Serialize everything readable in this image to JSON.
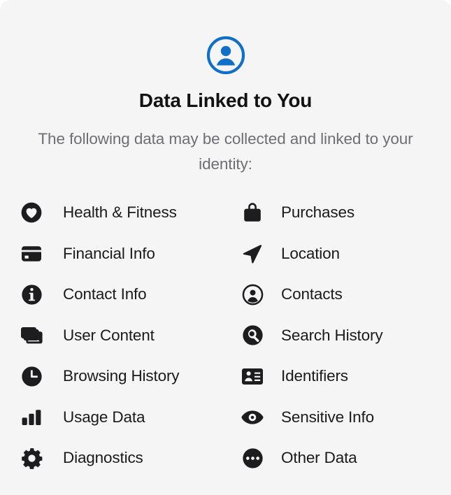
{
  "panel": {
    "header_icon": "person-circle-icon",
    "accent_color": "#1070c8",
    "title": "Data Linked to You",
    "subtitle": "The following data may be collected and linked to your identity:",
    "text_color": "#1a1a1c",
    "subtitle_color": "#6e6e73",
    "background_color": "#f5f5f5"
  },
  "left_column": [
    {
      "icon": "heart-circle-icon",
      "label": "Health & Fitness"
    },
    {
      "icon": "credit-card-icon",
      "label": "Financial Info"
    },
    {
      "icon": "info-circle-icon",
      "label": "Contact Info"
    },
    {
      "icon": "photo-stack-icon",
      "label": "User Content"
    },
    {
      "icon": "clock-icon",
      "label": "Browsing History"
    },
    {
      "icon": "bar-chart-icon",
      "label": "Usage Data"
    },
    {
      "icon": "gear-icon",
      "label": "Diagnostics"
    }
  ],
  "right_column": [
    {
      "icon": "shopping-bag-icon",
      "label": "Purchases"
    },
    {
      "icon": "location-arrow-icon",
      "label": "Location"
    },
    {
      "icon": "contacts-circle-icon",
      "label": "Contacts"
    },
    {
      "icon": "search-circle-icon",
      "label": "Search History"
    },
    {
      "icon": "id-card-icon",
      "label": "Identifiers"
    },
    {
      "icon": "eye-icon",
      "label": "Sensitive Info"
    },
    {
      "icon": "ellipsis-circle-icon",
      "label": "Other Data"
    }
  ]
}
